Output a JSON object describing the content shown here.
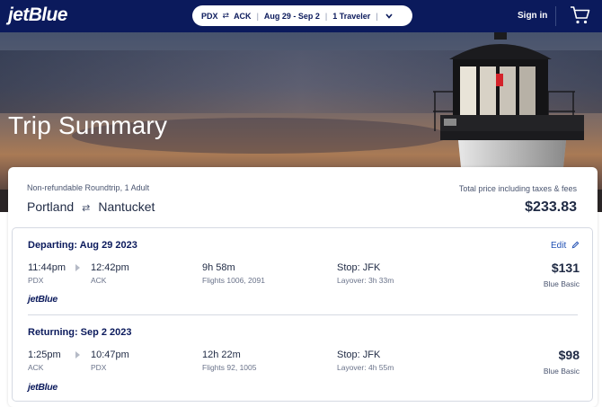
{
  "header": {
    "logo": "jetBlue",
    "search": {
      "origin": "PDX",
      "destination": "ACK",
      "swap_glyph": "⇄",
      "separator": "|",
      "dates": "Aug 29 - Sep 2",
      "travelers": "1 Traveler",
      "dropdown_icon": "chevron-down-icon"
    },
    "sign_in": "Sign in",
    "cart_icon": "cart-icon"
  },
  "hero": {
    "title": "Trip Summary"
  },
  "summary": {
    "fare_type": "Non-refundable Roundtrip, 1 Adult",
    "from_city": "Portland",
    "to_city": "Nantucket",
    "swap_glyph": "⇄",
    "total_label": "Total price including taxes & fees",
    "total_price": "$233.83"
  },
  "legs": [
    {
      "heading": "Departing: Aug 29 2023",
      "edit_label": "Edit",
      "depart_time": "11:44pm",
      "depart_code": "PDX",
      "arrive_time": "12:42pm",
      "arrive_code": "ACK",
      "duration": "9h 58m",
      "flights": "Flights 1006, 2091",
      "stop": "Stop: JFK",
      "layover": "Layover: 3h 33m",
      "price": "$131",
      "cabin": "Blue Basic",
      "carrier": "jetBlue"
    },
    {
      "heading": "Returning: Sep 2 2023",
      "depart_time": "1:25pm",
      "depart_code": "ACK",
      "arrive_time": "10:47pm",
      "arrive_code": "PDX",
      "duration": "12h 22m",
      "flights": "Flights 92, 1005",
      "stop": "Stop: JFK",
      "layover": "Layover: 4h 55m",
      "price": "$98",
      "cabin": "Blue Basic",
      "carrier": "jetBlue"
    }
  ],
  "colors": {
    "brand_navy": "#0b1a5c",
    "link_blue": "#1f4fb3",
    "text_dark": "#1f2a44"
  }
}
